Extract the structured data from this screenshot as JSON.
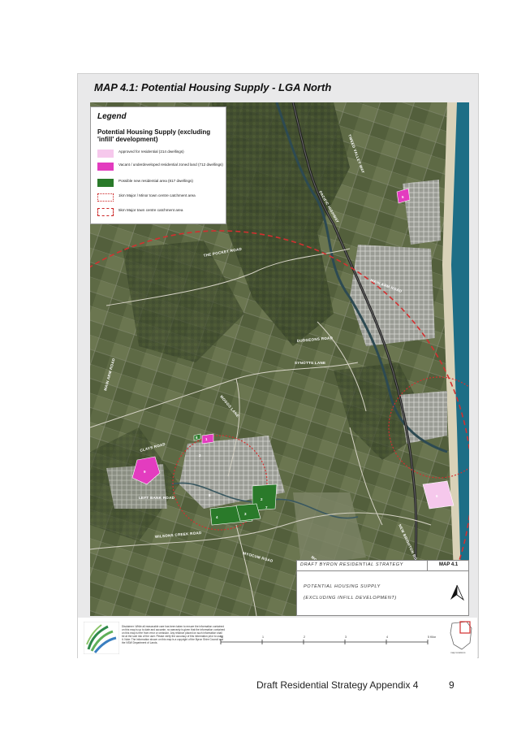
{
  "map": {
    "title": "MAP 4.1: Potential Housing Supply - LGA North",
    "road_labels": [
      "MAIN ARM ROAD",
      "THE POCKET ROAD",
      "PACIFIC HIGHWAY",
      "DUDGEONS ROAD",
      "SYNOTTS LANE",
      "MOGGS LANE",
      "TWEED VALLEY WAY",
      "CLAYS ROAD",
      "LEFT BANK ROAD",
      "WILSONS CREEK ROAD",
      "MYOCUM ROAD",
      "MCAULEYS LANE",
      "NEW BRIGHTON ROAD",
      "MAIN ARM ROAD"
    ],
    "site_labels": [
      "9",
      "1",
      "5",
      "6",
      "2",
      "4",
      "3",
      "8",
      "7",
      "8",
      "2"
    ]
  },
  "legend": {
    "title": "Legend",
    "subtitle": "Potential Housing Supply (excluding 'infill' development)",
    "items": [
      {
        "label": "Approved for residential (214 dwellings)",
        "color": "#f6c8ec"
      },
      {
        "label": "Vacant / underdeveloped residential zoned land (712 dwellings)",
        "color": "#e33cbf"
      },
      {
        "label": "Possible new residential area (817 dwellings)",
        "color": "#2a7a2a"
      },
      {
        "label": "1km Major / Minor town centre catchment area",
        "color": "#cc2222"
      },
      {
        "label": "5km Major town centre catchment area",
        "color": "#cc2222"
      }
    ]
  },
  "title_block": {
    "strategy": "DRAFT BYRON RESIDENTIAL STRATEGY",
    "map_no": "MAP 4.1",
    "line1": "POTENTIAL HOUSING SUPPLY",
    "line2": "(EXCLUDING INFILL DEVELOPMENT)"
  },
  "footer": {
    "disclaimer": "Disclaimer: While all reasonable care has been taken to ensure the information contained on this map is up to date and accurate, no warranty is given that the information contained on this map is free from error or omission. Any reliance placed on such information shall be at the sole risk of the user. Please verify the accuracy of this information prior to using it. Note: The information shown on this map is a copyright of the Byron Shire Council and the NSW Department of Lands.",
    "scale_ticks": [
      "0",
      "1",
      "2",
      "3",
      "4",
      "5 Kilometers"
    ],
    "inset_label": "map locations"
  },
  "page": {
    "caption": "Draft Residential Strategy Appendix 4",
    "number": "9"
  }
}
